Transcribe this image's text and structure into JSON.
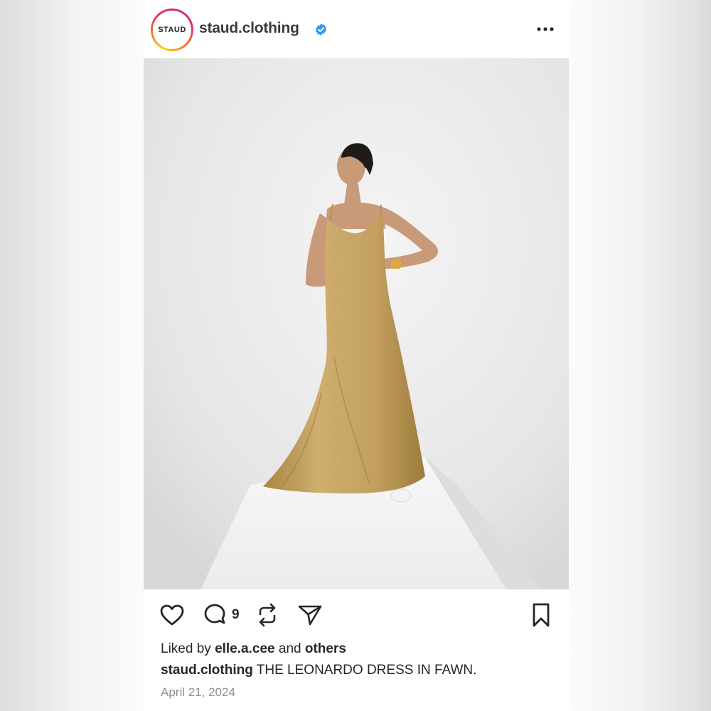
{
  "header": {
    "avatar_text": "STAUD",
    "username": "staud.clothing",
    "verified_icon": "verified-badge-icon",
    "more_icon": "more-options-icon"
  },
  "actions": {
    "like_icon": "heart-icon",
    "comment_icon": "comment-icon",
    "comment_count": "9",
    "repost_icon": "repost-icon",
    "share_icon": "send-icon",
    "save_icon": "bookmark-icon"
  },
  "likes": {
    "prefix": "Liked by",
    "user": "elle.a.cee",
    "conjunction": "and",
    "others": "others"
  },
  "caption": {
    "username": "staud.clothing",
    "text": "THE LEONARDO DRESS IN FAWN."
  },
  "date": "April 21, 2024",
  "colors": {
    "verified_blue": "#3897f0",
    "text": "#262626",
    "muted": "#8e8e8e",
    "dress": "#c8a465"
  }
}
